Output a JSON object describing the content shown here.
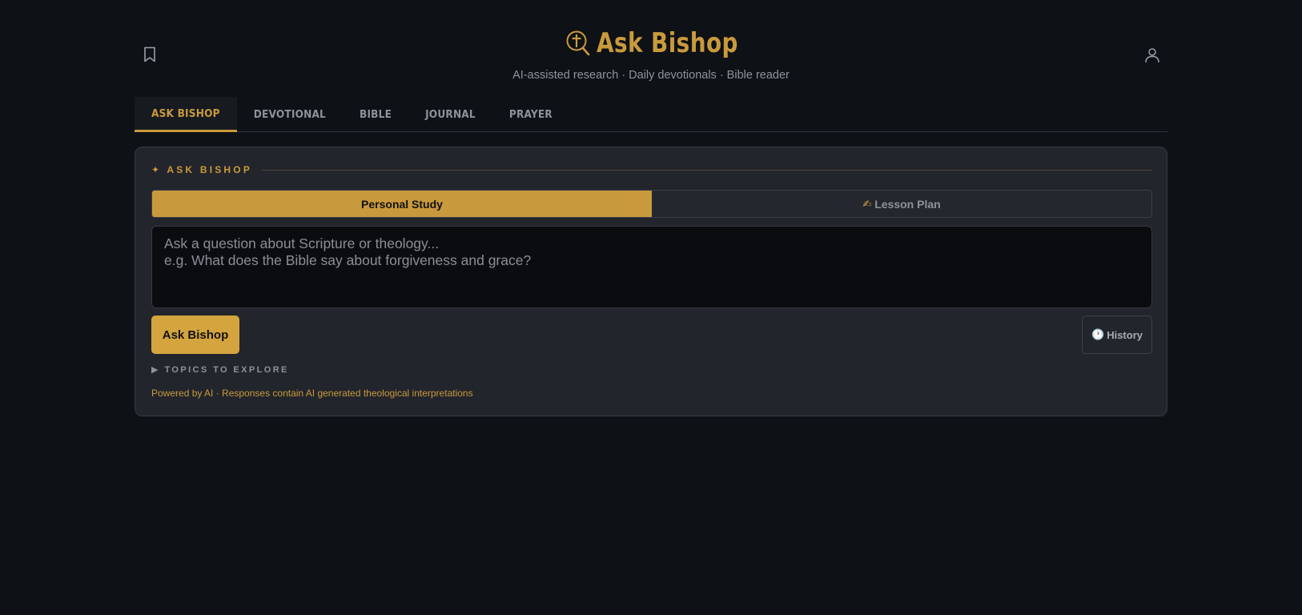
{
  "header": {
    "title": "Ask Bishop",
    "subtitle": "AI-assisted research · Daily devotionals · Bible reader",
    "brand_color": "#c99a3d",
    "icons": {
      "logo": "cross-magnifier-icon",
      "left": "bookmark-icon",
      "right": "user-icon"
    }
  },
  "tabs": [
    {
      "label": "Ask Bishop",
      "active": true
    },
    {
      "label": "Devotional",
      "active": false
    },
    {
      "label": "Bible",
      "active": false
    },
    {
      "label": "Journal",
      "active": false
    },
    {
      "label": "Prayer",
      "active": false
    }
  ],
  "card": {
    "section_icon": "✦",
    "section_label": "ASK BISHOP",
    "modes": [
      {
        "label": "Personal Study",
        "icon": "",
        "active": true
      },
      {
        "label": "Lesson Plan",
        "icon": "✍",
        "active": false
      }
    ],
    "question": {
      "value": "",
      "placeholder": "Ask a question about Scripture or theology...\ne.g. What does the Bible say about forgiveness and grace?"
    },
    "ask_label": "Ask Bishop",
    "history_icon": "🕐",
    "history_label": "History",
    "topics_label": "TOPICS TO EXPLORE",
    "footnote": "Powered by AI · Responses contain AI generated theological interpretations"
  }
}
